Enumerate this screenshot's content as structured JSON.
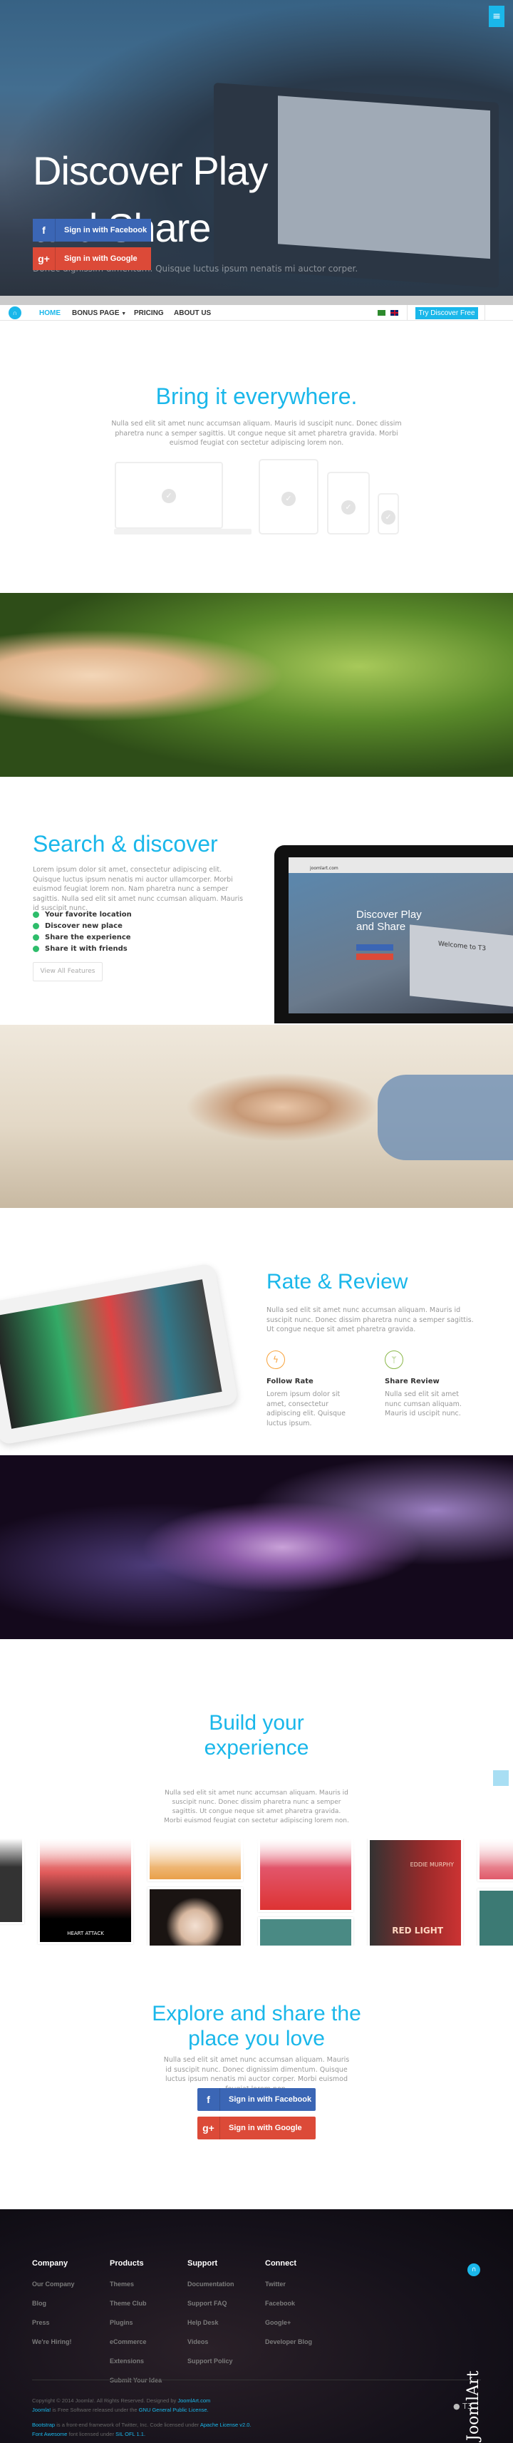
{
  "hero": {
    "title_line1": "Discover Play",
    "title_line2": "and Share",
    "subtitle": "Donec dignissim dimentum. Quisque luctus ipsum nenatis mi auctor corper.",
    "facebook_btn": "Sign in with Facebook",
    "google_btn": "Sign in with Google",
    "menu_icon": "hamburger-icon"
  },
  "nav": {
    "items": [
      "HOME",
      "BONUS PAGE",
      "PRICING",
      "ABOUT US"
    ],
    "cta": "Try Discover Free",
    "accent": "#1ab7ea"
  },
  "bring": {
    "title": "Bring it everywhere.",
    "text": "Nulla sed elit sit amet nunc accumsan aliquam. Mauris id suscipit nunc. Donec dissim pharetra nunc a semper sagittis. Ut congue neque sit amet pharetra gravida. Morbi euismod feugiat con sectetur adipiscing lorem non."
  },
  "search": {
    "title": "Search & discover",
    "text": "Lorem ipsum dolor sit amet, consectetur adipiscing elit. Quisque luctus ipsum nenatis mi auctor ullamcorper. Morbi euismod feugiat lorem non. Nam pharetra nunc a semper sagittis. Nulla sed elit sit amet nunc ccumsan aliquam. Mauris id suscipit nunc.",
    "features": [
      "Your favorite location",
      "Discover new place",
      "Share the experience",
      "Share it with friends"
    ],
    "button": "View All Features",
    "mock_title_line1": "Discover Play",
    "mock_title_line2": "and Share",
    "mock_welcome": "Welcome to T3",
    "mock_url": "joomlart.com"
  },
  "rate": {
    "title": "Rate & Review",
    "text": "Nulla sed elit sit amet nunc accumsan aliquam. Mauris id suscipit nunc. Donec dissim pharetra nunc a semper sagittis. Ut congue neque sit amet pharetra gravida.",
    "cols": [
      {
        "title": "Follow Rate",
        "text": "Lorem ipsum dolor sit amet, consectetur adipiscing elit. Quisque luctus ipsum.",
        "color": "#f7a23b"
      },
      {
        "title": "Share Review",
        "text": "Nulla sed elit sit amet nunc cumsan aliquam. Mauris id uscipit nunc.",
        "color": "#8bb84a"
      }
    ]
  },
  "build": {
    "title_line1": "Build your",
    "title_line2": "experience",
    "text": "Nulla sed elit sit amet nunc accumsan aliquam. Mauris id suscipit nunc. Donec dissim pharetra nunc a semper sagittis. Ut congue neque sit amet pharetra gravida. Morbi euismod feugiat con sectetur adipiscing lorem non.",
    "album_heart": "HEART ATTACK",
    "album_eddie": "EDDIE MURPHY",
    "album_red": "RED LIGHT"
  },
  "explore": {
    "title_line1": "Explore and share the",
    "title_line2": "place you love",
    "text": "Nulla sed elit sit amet nunc accumsan aliquam. Mauris id suscipit nunc. Donec dignissim dimentum. Quisque luctus ipsum nenatis mi auctor corper. Morbi euismod feugiat lorem non.",
    "facebook_btn": "Sign in with Facebook",
    "google_btn": "Sign in with Google"
  },
  "footer": {
    "columns": [
      {
        "title": "Company",
        "links": [
          "Our Company",
          "Blog",
          "Press",
          "We're Hiring!"
        ]
      },
      {
        "title": "Products",
        "links": [
          "Themes",
          "Theme Club",
          "Plugins",
          "eCommerce",
          "Extensions",
          "Submit Your Idea"
        ]
      },
      {
        "title": "Support",
        "links": [
          "Documentation",
          "Support FAQ",
          "Help Desk",
          "Videos",
          "Support Policy"
        ]
      },
      {
        "title": "Connect",
        "links": [
          "Twitter",
          "Facebook",
          "Google+",
          "Developer Blog"
        ]
      }
    ],
    "copy1": "Copyright © 2014 Joomla!. All Rights Reserved. Designed by",
    "copy1_link": "JoomlArt.com",
    "copy2_link": "Joomla!",
    "copy2": "is Free Software released under the",
    "copy2_link2": "GNU General Public License.",
    "copy3_link": "Bootstrap",
    "copy3": "is a front-end framework of Twitter, Inc. Code licensed under",
    "copy3_link2": "Apache License v2.0.",
    "copy4_link": "Font Awesome",
    "copy4": "font licensed under",
    "copy4_link2": "SIL OFL 1.1.",
    "t3": "T3",
    "brand_logo": "JoomlArt"
  }
}
